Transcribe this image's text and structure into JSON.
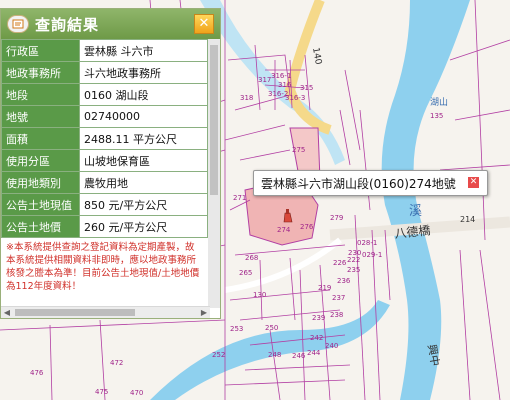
{
  "panel": {
    "title": "查詢結果",
    "icon": "document-icon",
    "close_icon": "close-icon",
    "rows": [
      {
        "key": "行政區",
        "value": "雲林縣 斗六市"
      },
      {
        "key": "地政事務所",
        "value": "斗六地政事務所"
      },
      {
        "key": "地段",
        "value": "0160 湖山段"
      },
      {
        "key": "地號",
        "value": "02740000"
      },
      {
        "key": "面積",
        "value": "2488.11 平方公尺"
      },
      {
        "key": "使用分區",
        "value": "山坡地保育區"
      },
      {
        "key": "使用地類別",
        "value": "農牧用地"
      },
      {
        "key": "公告土地現值",
        "value": "850 元/平方公尺"
      },
      {
        "key": "公告土地價",
        "value": "260 元/平方公尺"
      }
    ],
    "note": "※本系統提供查詢之登記資料為定期產製，故本系統提供相關資料非即時，應以地政事務所核發之謄本為準！目前公告土地現值/土地地價為112年度資料！"
  },
  "popup": {
    "text": "雲林縣斗六市湖山段(0160)274地號",
    "close_icon": "close-icon"
  },
  "map": {
    "parcel_labels": [
      "317",
      "316-1",
      "316",
      "316-2",
      "316-3",
      "315",
      "318",
      "275",
      "271",
      "274",
      "276",
      "279",
      "130",
      "250",
      "248",
      "246",
      "244",
      "242",
      "240",
      "239",
      "238",
      "237",
      "253",
      "265",
      "268",
      "236",
      "235",
      "230",
      "226",
      "222",
      "219",
      "028-1",
      "029-1",
      "476",
      "472",
      "470",
      "475",
      "135"
    ],
    "road_labels": [
      "八德橋",
      "湖山",
      "溪",
      "140",
      "214",
      "興中"
    ],
    "colors": {
      "water": "#8ed0ee",
      "parcel_lines": "#b23fa3",
      "highlight": "#f0b4b4",
      "road": "#f7e4b4"
    }
  }
}
